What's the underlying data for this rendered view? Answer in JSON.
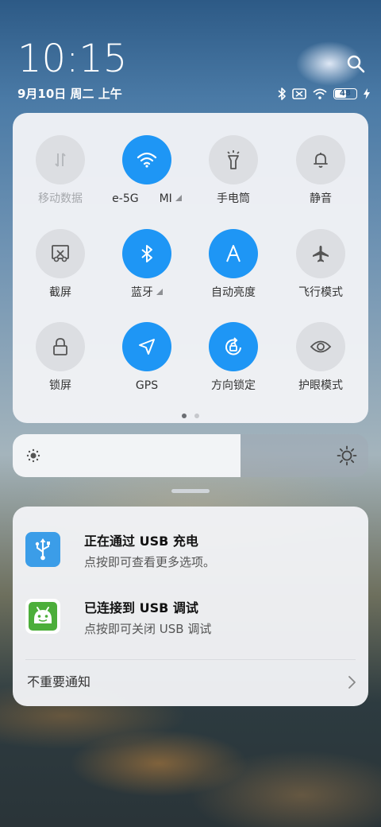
{
  "status": {
    "time": "10:15",
    "date": "9月10日 周二 上午",
    "battery": "48",
    "icons": [
      "bluetooth-icon",
      "no-sim-icon",
      "wifi-icon",
      "battery-icon",
      "charging-icon"
    ]
  },
  "quick_settings": {
    "tiles": [
      {
        "label": "移动数据",
        "icon": "mobile-data-icon",
        "on": false
      },
      {
        "label_left": "e-5G",
        "label_right": "MI",
        "icon": "wifi-icon",
        "on": true
      },
      {
        "label": "手电筒",
        "icon": "flashlight-icon",
        "on": false
      },
      {
        "label": "静音",
        "icon": "bell-icon",
        "on": false
      },
      {
        "label": "截屏",
        "icon": "screenshot-icon",
        "on": false
      },
      {
        "label": "蓝牙",
        "icon": "bluetooth-icon",
        "on": true
      },
      {
        "label": "自动亮度",
        "icon": "auto-brightness-icon",
        "on": true
      },
      {
        "label": "飞行模式",
        "icon": "airplane-icon",
        "on": false
      },
      {
        "label": "锁屏",
        "icon": "lock-icon",
        "on": false
      },
      {
        "label": "GPS",
        "icon": "location-icon",
        "on": true
      },
      {
        "label": "方向锁定",
        "icon": "rotation-lock-icon",
        "on": true
      },
      {
        "label": "护眼模式",
        "icon": "eye-icon",
        "on": false
      }
    ],
    "page": 1,
    "pages": 2
  },
  "brightness": {
    "level": 0.64
  },
  "notifications": [
    {
      "title": "正在通过 USB 充电",
      "subtitle": "点按即可查看更多选项。",
      "icon": "usb-icon",
      "color": "#3b9de8"
    },
    {
      "title": "已连接到 USB 调试",
      "subtitle": "点按即可关闭 USB 调试",
      "icon": "android-icon",
      "color": "#4cae3a"
    }
  ],
  "unimportant_label": "不重要通知",
  "colors": {
    "accent": "#1e96f5",
    "tile_off": "#dcdee2"
  }
}
